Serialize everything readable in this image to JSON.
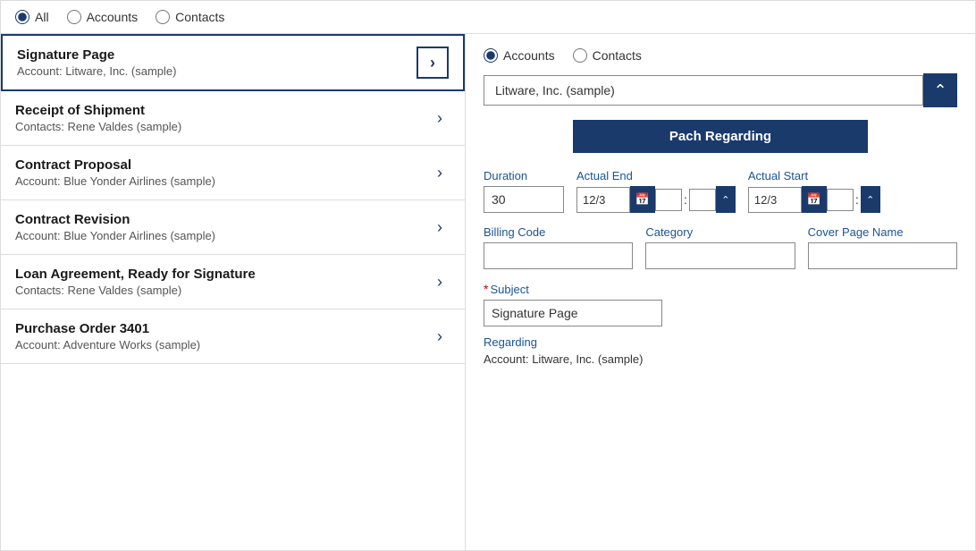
{
  "top_radio": {
    "options": [
      {
        "id": "all",
        "label": "All",
        "checked": true
      },
      {
        "id": "accounts",
        "label": "Accounts",
        "checked": false
      },
      {
        "id": "contacts",
        "label": "Contacts",
        "checked": false
      }
    ]
  },
  "list_items": [
    {
      "title": "Signature Page",
      "subtitle": "Account: Litware, Inc. (sample)",
      "active": true
    },
    {
      "title": "Receipt of Shipment",
      "subtitle": "Contacts: Rene Valdes (sample)",
      "active": false
    },
    {
      "title": "Contract Proposal",
      "subtitle": "Account: Blue Yonder Airlines (sample)",
      "active": false
    },
    {
      "title": "Contract Revision",
      "subtitle": "Account: Blue Yonder Airlines (sample)",
      "active": false
    },
    {
      "title": "Loan Agreement, Ready for Signature",
      "subtitle": "Contacts: Rene Valdes (sample)",
      "active": false
    },
    {
      "title": "Purchase Order 3401",
      "subtitle": "Account: Adventure Works (sample)",
      "active": false
    }
  ],
  "right_panel": {
    "radio_options": [
      {
        "id": "r_accounts",
        "label": "Accounts",
        "checked": true
      },
      {
        "id": "r_contacts",
        "label": "Contacts",
        "checked": false
      }
    ],
    "dropdown_value": "Litware, Inc. (sample)",
    "patch_button_label": "Pach Regarding",
    "form": {
      "duration_label": "Duration",
      "duration_value": "30",
      "actual_end_label": "Actual End",
      "actual_end_date": "12/3",
      "actual_start_label": "Actual Start",
      "actual_start_date": "12/3",
      "billing_code_label": "Billing Code",
      "billing_code_value": "",
      "category_label": "Category",
      "category_value": "",
      "cover_page_name_label": "Cover Page Name",
      "cover_page_name_value": "",
      "subject_label": "Subject",
      "subject_required": true,
      "subject_value": "Signature Page",
      "regarding_label": "Regarding",
      "regarding_value": "Account: Litware, Inc. (sample)"
    }
  }
}
